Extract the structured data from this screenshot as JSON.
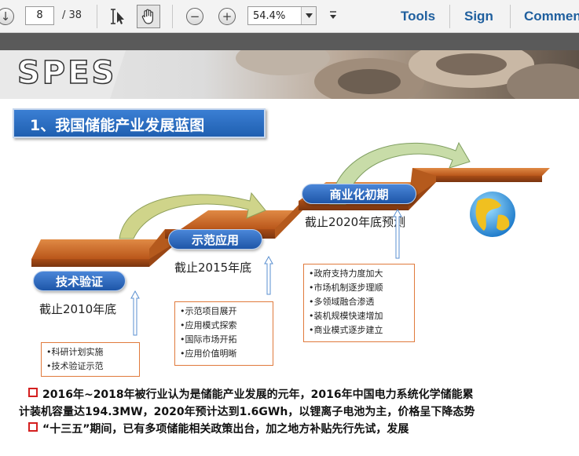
{
  "toolbar": {
    "page_current": "8",
    "page_total": "/ 38",
    "zoom": "54.4%",
    "tools_label": "Tools",
    "sign_label": "Sign",
    "comment_label": "Comment",
    "zoom_out_glyph": "−",
    "zoom_in_glyph": "+",
    "down_glyph": "↓"
  },
  "slide": {
    "logo": "SPES",
    "title": "1、我国储能产业发展蓝图",
    "stages": [
      {
        "label": "技术验证",
        "date": "截止2010年底",
        "items": [
          "•科研计划实施",
          "•技术验证示范"
        ]
      },
      {
        "label": "示范应用",
        "date": "截止2015年底",
        "items": [
          "•示范项目展开",
          "•应用模式探索",
          "•国际市场开拓",
          "•应用价值明晰"
        ]
      },
      {
        "label": "商业化初期",
        "date": "截止2020年底预测",
        "items": [
          "•政府支持力度加大",
          "•市场机制逐步理顺",
          "•多领域融合渗透",
          "•装机规模快速增加",
          "•商业模式逐步建立"
        ]
      }
    ],
    "bullets": [
      "2016年~2018年被行业认为是储能产业发展的元年，2016年中国电力系统化学储能累",
      "计装机容量达194.3MW，2020年预计达到1.6GWh，以锂离子电池为主，价格呈下降态势",
      "“十三五”期间，已有多项储能相关政策出台，加之地方补贴先行先试，发展"
    ]
  },
  "colors": {
    "accent_blue": "#1f5fb0",
    "stair_orange": "#c0611f",
    "link_blue": "#1f5f9e",
    "box_border": "#e07a3c"
  }
}
